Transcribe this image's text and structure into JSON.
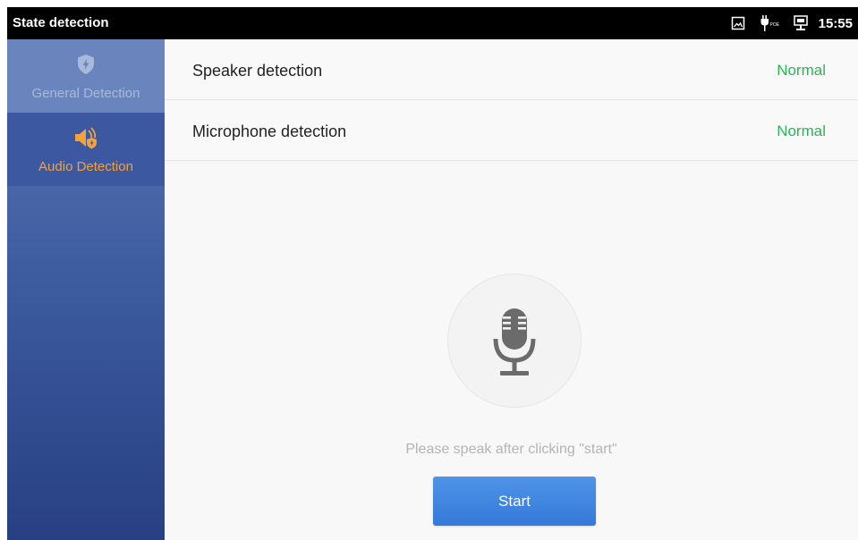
{
  "statusbar": {
    "title": "State detection",
    "time": "15:55",
    "icons": [
      "screenshot-icon",
      "poe-icon",
      "ethernet-icon"
    ]
  },
  "sidebar": {
    "items": [
      {
        "label": "General Detection",
        "icon": "shield-bolt-icon",
        "selected": false
      },
      {
        "label": "Audio Detection",
        "icon": "speaker-shield-icon",
        "selected": true
      }
    ]
  },
  "detections": [
    {
      "name": "Speaker detection",
      "status": "Normal"
    },
    {
      "name": "Microphone detection",
      "status": "Normal"
    }
  ],
  "mic_panel": {
    "icon": "microphone-icon",
    "hint": "Please speak after clicking \"start\"",
    "start_label": "Start"
  },
  "colors": {
    "accent_orange": "#f6a13a",
    "status_green": "#2bb457",
    "button_blue": "#3f86e0",
    "sidebar_blue": "#3e5da1"
  }
}
